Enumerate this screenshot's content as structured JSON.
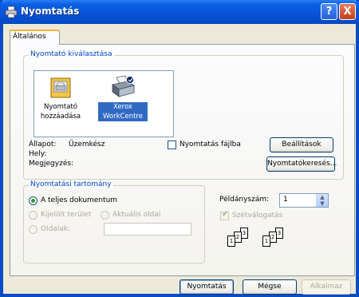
{
  "window": {
    "title": "Nyomtatás",
    "help_icon": "?",
    "close_icon": "X"
  },
  "tabs": [
    {
      "label": "Általános"
    }
  ],
  "printer_section": {
    "legend": "Nyomtató kiválasztása",
    "printers": [
      {
        "label_line1": "Nyomtató",
        "label_line2": "hozzáadása",
        "icon": "add-printer-icon"
      },
      {
        "label_line1": "Xerox",
        "label_line2": "WorkCentre",
        "icon": "printer-icon",
        "selected": true
      }
    ],
    "status_label": "Állapot:",
    "status_value": "Üzemkész",
    "location_label": "Hely:",
    "comment_label": "Megjegyzés:",
    "print_to_file_label": "Nyomtatás fájlba",
    "preferences_button": "Beállítások",
    "find_printer_button": "Nyomtatókeresés..."
  },
  "range_section": {
    "legend": "Nyomtatási tartomány",
    "all_label": "A teljes dokumentum",
    "selection_label": "Kijelölt terület",
    "current_page_label": "Aktuális oldal",
    "pages_label": "Oldalak:",
    "pages_value": ""
  },
  "copies": {
    "label": "Példányszám:",
    "value": "1",
    "collate_label": "Szétválogatás",
    "collate_checked": true,
    "collated_set_a": [
      "1",
      "2",
      "3"
    ],
    "collated_set_b": [
      "1",
      "2",
      "3"
    ]
  },
  "buttons": {
    "print": "Nyomtatás",
    "cancel": "Mégse",
    "apply": "Alkalmaz"
  }
}
